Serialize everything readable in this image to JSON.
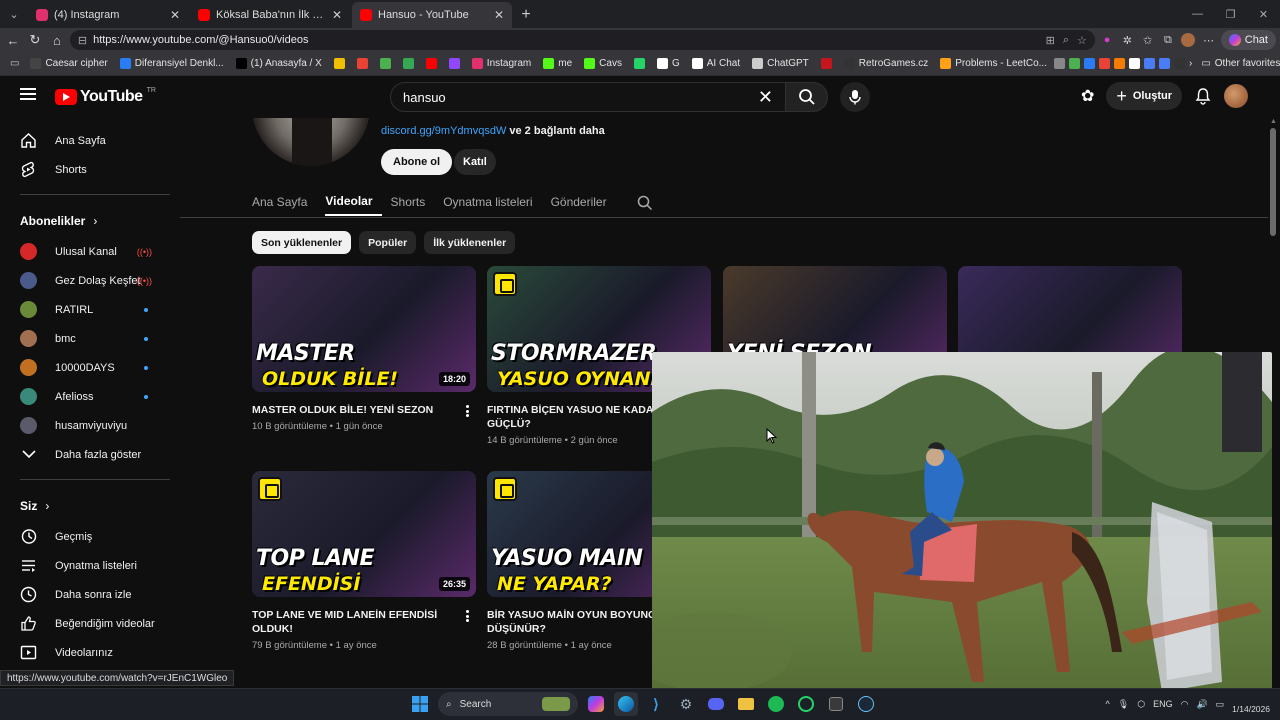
{
  "browser": {
    "tabs": [
      {
        "title": "(4) Instagram",
        "color": "#e1306c",
        "active": false
      },
      {
        "title": "Köksal Baba'nın İlk Kez Ata Bi...",
        "color": "#ff0000",
        "active": false
      },
      {
        "title": "Hansuo - YouTube",
        "color": "#ff0000",
        "active": true
      }
    ],
    "url": "https://www.youtube.com/@Hansuo0/videos",
    "copilot_label": "Chat",
    "bookmarks": [
      {
        "label": "Caesar cipher",
        "color": "#444"
      },
      {
        "label": "Diferansiyel Denkl...",
        "color": "#2a7cf5"
      },
      {
        "label": "(1) Anasayfa / X",
        "color": "#000"
      },
      {
        "label": "",
        "color": "#f0c000"
      },
      {
        "label": "",
        "color": "#ea4335"
      },
      {
        "label": "",
        "color": "#4caf50"
      },
      {
        "label": "",
        "color": "#34a853"
      },
      {
        "label": "",
        "color": "#ff0000"
      },
      {
        "label": "",
        "color": "#9146ff"
      },
      {
        "label": "Instagram",
        "color": "#e1306c"
      },
      {
        "label": "me",
        "color": "#53fc18"
      },
      {
        "label": "Cavs",
        "color": "#53fc18"
      },
      {
        "label": "",
        "color": "#25d366"
      },
      {
        "label": "G",
        "color": "#fff"
      },
      {
        "label": "AI Chat",
        "color": "#fff"
      },
      {
        "label": "ChatGPT",
        "color": "#ccc"
      },
      {
        "label": "",
        "color": "#c4161c"
      },
      {
        "label": "RetroGames.cz",
        "color": "#333"
      },
      {
        "label": "Problems - LeetCo...",
        "color": "#ffa116"
      }
    ],
    "other_favorites": "Other favorites",
    "status_url": "https://www.youtube.com/watch?v=rJEnC1WGleo"
  },
  "youtube": {
    "logo_text": "YouTube",
    "country": "TR",
    "search_query": "hansuo",
    "create_label": "Oluştur"
  },
  "sidebar": {
    "main": [
      {
        "label": "Ana Sayfa",
        "icon": "home-icon"
      },
      {
        "label": "Shorts",
        "icon": "shorts-icon"
      }
    ],
    "subscriptions_title": "Abonelikler",
    "subscriptions": [
      {
        "label": "Ulusal Kanal",
        "color": "#d62828",
        "status": "live"
      },
      {
        "label": "Gez Dolaş Keşfet",
        "color": "#4a5a8a",
        "status": "live"
      },
      {
        "label": "RATIRL",
        "color": "#6a8a3a",
        "status": "new"
      },
      {
        "label": "bmc",
        "color": "#a07050",
        "status": "new"
      },
      {
        "label": "10000DAYS",
        "color": "#c07020",
        "status": "new"
      },
      {
        "label": "Afelioss",
        "color": "#3a8a7a",
        "status": "new"
      },
      {
        "label": "husamviyuviyu",
        "color": "#5a5a6a",
        "status": ""
      }
    ],
    "show_more": "Daha fazla göster",
    "you_title": "Siz",
    "you_items": [
      {
        "label": "Geçmiş",
        "icon": "history-icon"
      },
      {
        "label": "Oynatma listeleri",
        "icon": "playlists-icon"
      },
      {
        "label": "Daha sonra izle",
        "icon": "watch-later-icon"
      },
      {
        "label": "Beğendiğim videolar",
        "icon": "like-icon"
      },
      {
        "label": "Videolarınız",
        "icon": "your-videos-icon"
      }
    ]
  },
  "channel": {
    "link_text": "discord.gg/9mYdmvqsdW",
    "more_links": "ve 2 bağlantı daha",
    "subscribe_label": "Abone ol",
    "join_label": "Katıl",
    "tabs": [
      "Ana Sayfa",
      "Videolar",
      "Shorts",
      "Oynatma listeleri",
      "Gönderiler"
    ],
    "active_tab": "Videolar",
    "chips": [
      "Son yüklenenler",
      "Popüler",
      "İlk yüklenenler"
    ]
  },
  "videos": [
    {
      "title": "MASTER OLDUK BİLE! YENİ SEZON",
      "views": "10 B görüntüleme",
      "age": "1 gün önce",
      "duration": "18:20",
      "thumb_text": "MASTER",
      "thumb_sub": "OLDUK BİLE!",
      "bg": "#3a2a4a"
    },
    {
      "title": "FIRTINA BİÇEN YASUO NE KADAR GÜÇLÜ?",
      "views": "14 B görüntüleme",
      "age": "2 gün önce",
      "duration": "",
      "thumb_text": "STORMRAZER",
      "thumb_sub": "YASUO OYNANIŞ",
      "bg": "#2a4a3a"
    },
    {
      "title": "",
      "views": "",
      "age": "",
      "duration": "",
      "thumb_text": "YENİ SEZON",
      "thumb_sub": "",
      "bg": "#4a3a2a"
    },
    {
      "title": "",
      "views": "",
      "age": "",
      "duration": "",
      "thumb_text": "",
      "thumb_sub": "",
      "bg": "#3a2a5a"
    },
    {
      "title": "TOP LANE VE MID LANEİN EFENDİSİ OLDUK!",
      "views": "79 B görüntüleme",
      "age": "1 ay önce",
      "duration": "26:35",
      "thumb_text": "TOP LANE",
      "thumb_sub": "EFENDİSİ",
      "bg": "#2a2a3a"
    },
    {
      "title": "BİR YASUO MAİN OYUN BOYUNCA NE DÜŞÜNÜR?",
      "views": "28 B görüntüleme",
      "age": "1 ay önce",
      "duration": "",
      "thumb_text": "YASUO MAIN",
      "thumb_sub": "NE YAPAR?",
      "bg": "#2a3a4a"
    }
  ],
  "taskbar": {
    "search_label": "Search",
    "language": "ENG",
    "date": "1/14/2026"
  }
}
